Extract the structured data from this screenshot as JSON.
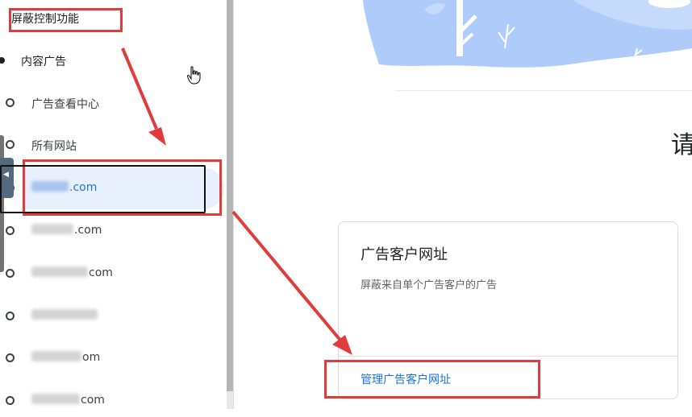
{
  "sidebar": {
    "section_title": "屏蔽控制功能",
    "parent_item": "内容广告",
    "items": [
      {
        "label": "广告查看中心",
        "blurred": false,
        "suffix": ""
      },
      {
        "label": "所有网站",
        "blurred": false,
        "suffix": ""
      },
      {
        "label": "",
        "blurred": true,
        "suffix": ".com",
        "selected": true
      },
      {
        "label": "",
        "blurred": true,
        "suffix": ".com"
      },
      {
        "label": "",
        "blurred": true,
        "suffix": "com"
      },
      {
        "label": "",
        "blurred": true,
        "suffix": ""
      },
      {
        "label": "",
        "blurred": true,
        "suffix": "om"
      },
      {
        "label": "",
        "blurred": true,
        "suffix": "com"
      }
    ]
  },
  "main": {
    "heading_char": "请",
    "card": {
      "title": "广告客户网址",
      "description": "屏蔽来自单个广告客户的广告",
      "link": "管理广告客户网址"
    }
  },
  "colors": {
    "accent": "#1a73e8",
    "annotation": "#e03c3c",
    "selected_bg": "#e8f0fe",
    "hero_illustration": "#aecbfa"
  },
  "icons": [
    "hand-pointer-icon",
    "collapse-arrow-icon"
  ]
}
